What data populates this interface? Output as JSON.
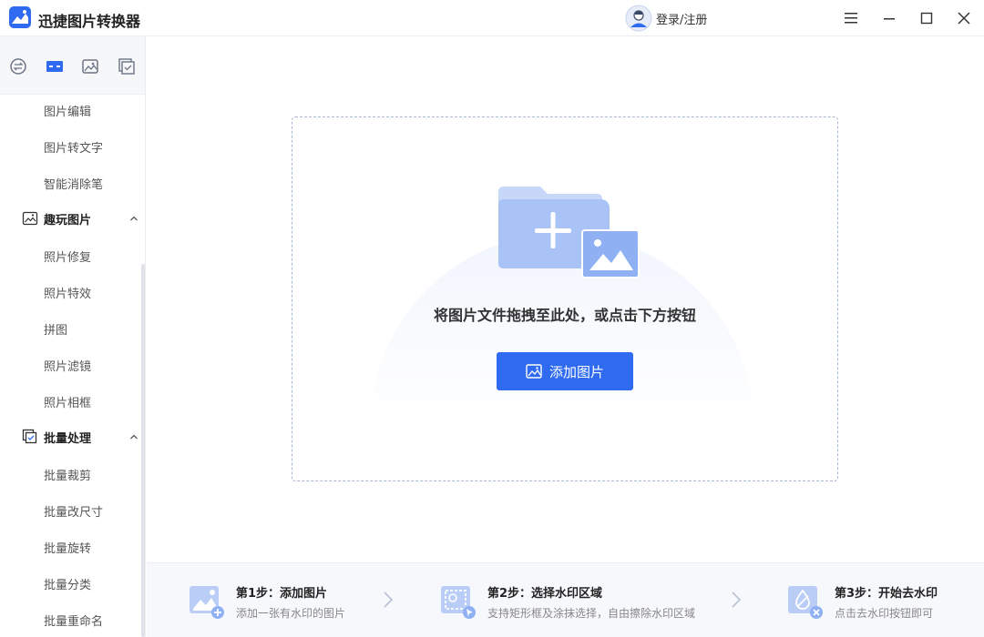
{
  "app": {
    "title": "迅捷图片转换器"
  },
  "header": {
    "login_label": "登录/注册"
  },
  "colors": {
    "accent": "#2f6bf0",
    "icon_light": "#b9cdf7",
    "icon_mid": "#8fb0f3"
  },
  "sidebar": {
    "tabs": [
      {
        "icon": "convert-icon"
      },
      {
        "icon": "image-edit-tab-icon",
        "active": true
      },
      {
        "icon": "picture-icon"
      },
      {
        "icon": "batch-icon"
      }
    ],
    "items_top": [
      "图片编辑",
      "图片转文字",
      "智能消除笔"
    ],
    "group_fun": {
      "label": "趣玩图片",
      "items": [
        "照片修复",
        "照片特效",
        "拼图",
        "照片滤镜",
        "照片相框"
      ]
    },
    "group_batch": {
      "label": "批量处理",
      "items": [
        "批量裁剪",
        "批量改尺寸",
        "批量旋转",
        "批量分类",
        "批量重命名"
      ]
    }
  },
  "dropzone": {
    "hint": "将图片文件拖拽至此处，或点击下方按钮",
    "button_label": "添加图片"
  },
  "steps": [
    {
      "title": "第1步：添加图片",
      "desc": "添加一张有水印的图片"
    },
    {
      "title": "第2步：选择水印区域",
      "desc": "支持矩形框及涂抹选择，自由擦除水印区域"
    },
    {
      "title": "第3步：开始去水印",
      "desc": "点击去水印按钮即可"
    }
  ]
}
